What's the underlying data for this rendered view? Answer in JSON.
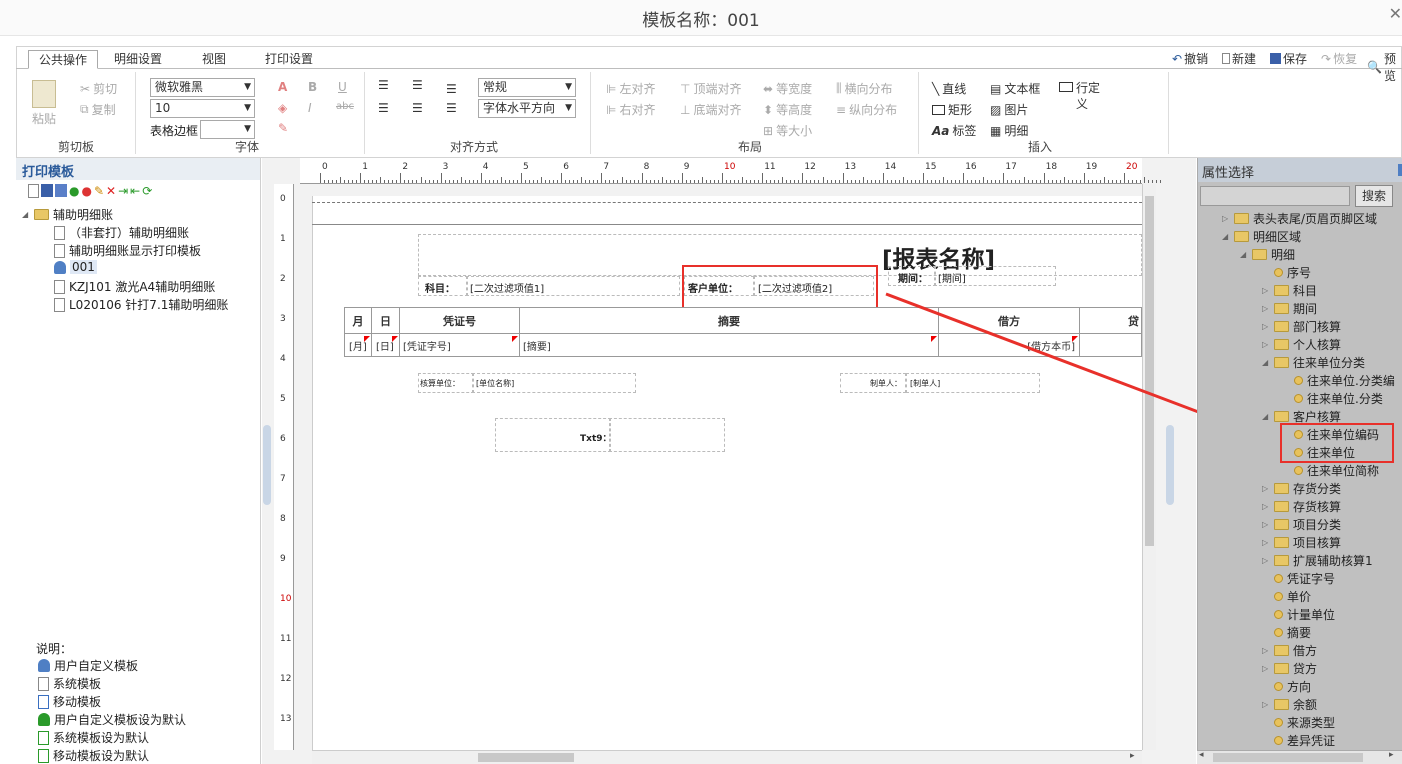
{
  "window": {
    "title": "模板名称：001"
  },
  "tabs": [
    "公共操作",
    "明细设置",
    "视图",
    "打印设置"
  ],
  "top_right_actions": [
    {
      "label": "撤销",
      "enabled": true
    },
    {
      "label": "新建",
      "enabled": true
    },
    {
      "label": "保存",
      "enabled": true
    },
    {
      "label": "恢复",
      "enabled": false
    },
    {
      "label": "预览",
      "enabled": true
    }
  ],
  "clipboard": {
    "paste": "粘贴",
    "cut": "剪切",
    "copy": "复制",
    "group": "剪切板"
  },
  "font": {
    "family": "微软雅黑",
    "size": "10",
    "border_label": "表格边框",
    "border_value": "",
    "bold": "B",
    "italic": "I",
    "underline": "U",
    "strike": "abc",
    "group": "字体"
  },
  "align": {
    "style": "常规",
    "direction": "字体水平方向",
    "group": "对齐方式"
  },
  "layout": {
    "items": [
      "左对齐",
      "右对齐",
      "顶端对齐",
      "底端对齐",
      "等宽度",
      "等高度",
      "等大小",
      "横向分布",
      "纵向分布"
    ],
    "group": "布局"
  },
  "insert": {
    "items": [
      "直线",
      "矩形",
      "标签",
      "文本框",
      "图片",
      "明细",
      "行定义"
    ],
    "group": "插入"
  },
  "left_panel": {
    "title": "打印模板",
    "root": "辅助明细账",
    "children": [
      "（非套打）辅助明细账",
      "辅助明细账显示打印模板",
      "001",
      "KZJ101 激光A4辅助明细账",
      "L020106 针打7.1辅助明细账"
    ],
    "legend_title": "说明：",
    "legend": [
      "用户自定义模板",
      "系统模板",
      "移动模板",
      "用户自定义模板设为默认",
      "系统模板设为默认",
      "移动模板设为默认"
    ]
  },
  "ruler": {
    "h": [
      "0",
      "1",
      "2",
      "3",
      "4",
      "5",
      "6",
      "7",
      "8",
      "9",
      "10",
      "11",
      "12",
      "13",
      "14",
      "15",
      "16",
      "17",
      "18",
      "19",
      "20"
    ],
    "v": [
      "0",
      "1",
      "2",
      "3",
      "4",
      "5",
      "6",
      "7",
      "8",
      "9",
      "10",
      "11",
      "12",
      "13"
    ]
  },
  "report": {
    "title": "[报表名称]",
    "subject_label": "科目：",
    "subject_value": "[二次过滤项值1]",
    "customer_label": "客户单位：",
    "customer_value": "[二次过滤项值2]",
    "period_label": "期间：",
    "period_value": "[期间]",
    "headers": [
      "月",
      "日",
      "凭证号",
      "摘要",
      "借方",
      "贷"
    ],
    "row": [
      "[月]",
      "[日]",
      "[凭证字号]",
      "[摘要]",
      "[借方本币]"
    ],
    "acct_label": "核算单位：",
    "acct_value": "[单位名称]",
    "maker_label": "制单人：",
    "maker_value": "[制单人]",
    "txt9": "Txt9："
  },
  "right_panel": {
    "title": "属性选择",
    "search_button": "搜索",
    "tree": [
      {
        "label": "表头表尾/页眉页脚区域",
        "kind": "folder",
        "level": 1,
        "caret": "right"
      },
      {
        "label": "明细区域",
        "kind": "folder",
        "level": 1,
        "caret": "down"
      },
      {
        "label": "明细",
        "kind": "folder",
        "level": 2,
        "caret": "down"
      },
      {
        "label": "序号",
        "kind": "dot",
        "level": 3
      },
      {
        "label": "科目",
        "kind": "folder",
        "level": 3,
        "caret": "right"
      },
      {
        "label": "期间",
        "kind": "folder",
        "level": 3,
        "caret": "right"
      },
      {
        "label": "部门核算",
        "kind": "folder",
        "level": 3,
        "caret": "right"
      },
      {
        "label": "个人核算",
        "kind": "folder",
        "level": 3,
        "caret": "right"
      },
      {
        "label": "往来单位分类",
        "kind": "folder",
        "level": 3,
        "caret": "down"
      },
      {
        "label": "往来单位.分类编",
        "kind": "dot",
        "level": 4
      },
      {
        "label": "往来单位.分类",
        "kind": "dot",
        "level": 4
      },
      {
        "label": "客户核算",
        "kind": "folder",
        "level": 3,
        "caret": "down"
      },
      {
        "label": "往来单位编码",
        "kind": "dot",
        "level": 4
      },
      {
        "label": "往来单位",
        "kind": "dot",
        "level": 4
      },
      {
        "label": "往来单位简称",
        "kind": "dot",
        "level": 4
      },
      {
        "label": "存货分类",
        "kind": "folder",
        "level": 3,
        "caret": "right"
      },
      {
        "label": "存货核算",
        "kind": "folder",
        "level": 3,
        "caret": "right"
      },
      {
        "label": "项目分类",
        "kind": "folder",
        "level": 3,
        "caret": "right"
      },
      {
        "label": "项目核算",
        "kind": "folder",
        "level": 3,
        "caret": "right"
      },
      {
        "label": "扩展辅助核算1",
        "kind": "folder",
        "level": 3,
        "caret": "right"
      },
      {
        "label": "凭证字号",
        "kind": "dot",
        "level": 3
      },
      {
        "label": "单价",
        "kind": "dot",
        "level": 3
      },
      {
        "label": "计量单位",
        "kind": "dot",
        "level": 3
      },
      {
        "label": "摘要",
        "kind": "dot",
        "level": 3
      },
      {
        "label": "借方",
        "kind": "folder",
        "level": 3,
        "caret": "right"
      },
      {
        "label": "贷方",
        "kind": "folder",
        "level": 3,
        "caret": "right"
      },
      {
        "label": "方向",
        "kind": "dot",
        "level": 3
      },
      {
        "label": "余额",
        "kind": "folder",
        "level": 3,
        "caret": "right"
      },
      {
        "label": "来源类型",
        "kind": "dot",
        "level": 3
      },
      {
        "label": "差异凭证",
        "kind": "dot",
        "level": 3
      }
    ]
  },
  "colors": {
    "highlight": "#e8302a",
    "accent": "#2a5a9a"
  }
}
